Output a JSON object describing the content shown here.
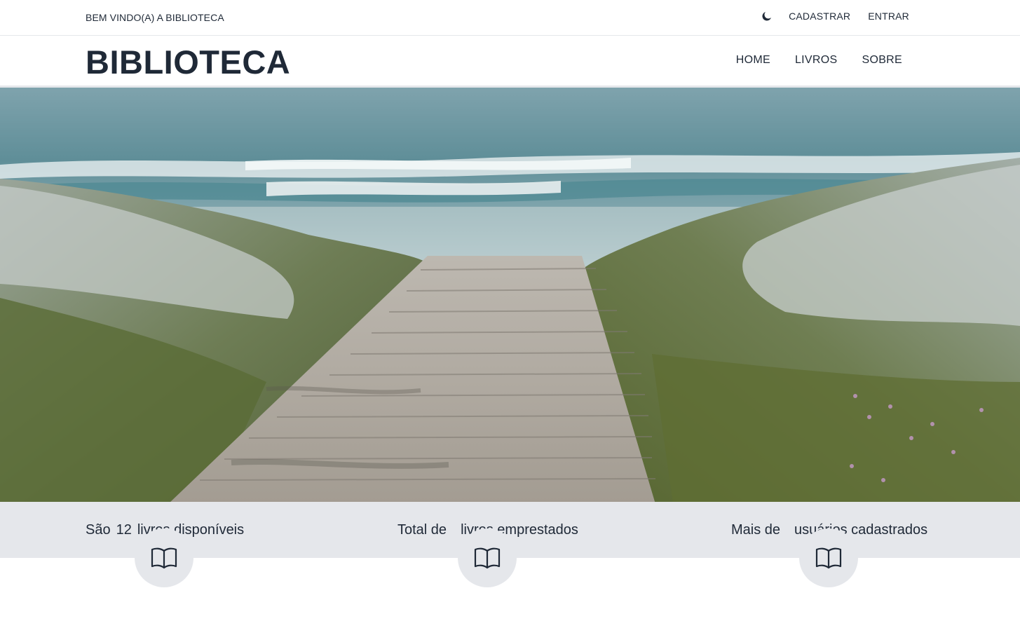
{
  "topbar": {
    "welcome": "BEM VINDO(A) A BIBLIOTECA",
    "theme_icon": "moon-icon",
    "register_label": "CADASTRAR",
    "login_label": "ENTRAR"
  },
  "navbar": {
    "brand": "BIBLIOTECA",
    "links": [
      "HOME",
      "LIVROS",
      "SOBRE"
    ]
  },
  "hero": {
    "image": "beach-boardwalk-photo"
  },
  "stats": [
    {
      "prefix": "São",
      "value": "12",
      "suffix": "livros disponíveis",
      "icon": "open-book-icon"
    },
    {
      "prefix": "Total de",
      "value": "",
      "suffix": "livros emprestados",
      "icon": "open-book-icon"
    },
    {
      "prefix": "Mais de",
      "value": "",
      "suffix": "usuários cadastrados",
      "icon": "open-book-icon"
    }
  ],
  "colors": {
    "text": "#1f2937",
    "stats_band": "#e5e7eb",
    "background": "#ffffff"
  }
}
